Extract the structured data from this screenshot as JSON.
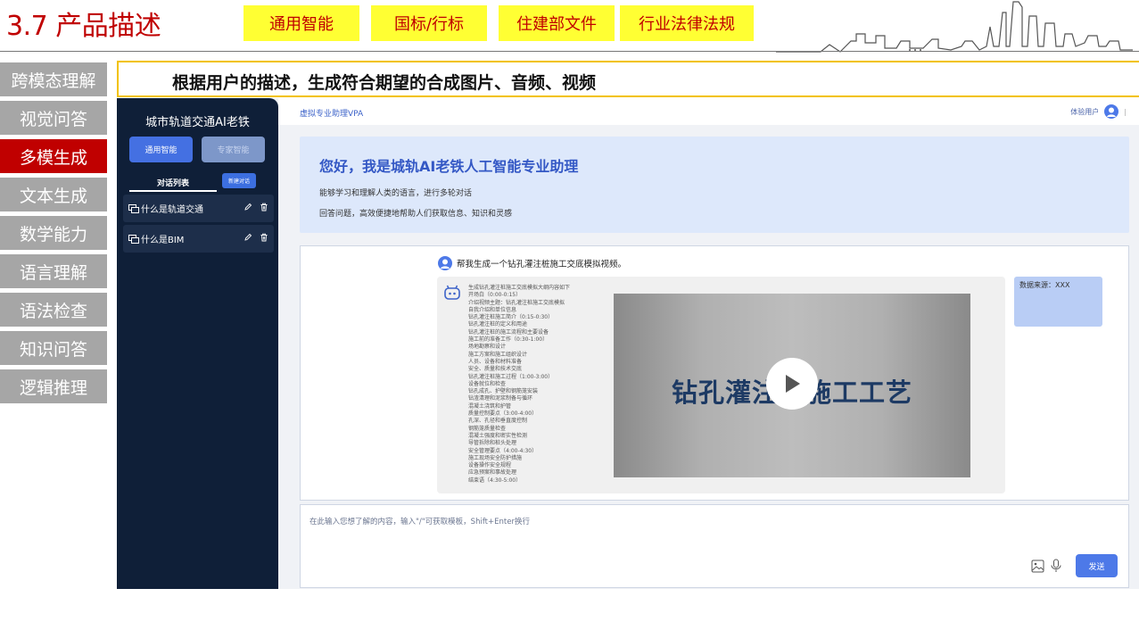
{
  "header": {
    "title": "3.7 产品描述",
    "tags": [
      "通用智能",
      "国标/行标",
      "住建部文件",
      "行业法律法规"
    ]
  },
  "sidebar": {
    "items": [
      "跨模态理解",
      "视觉问答",
      "多模生成",
      "文本生成",
      "数学能力",
      "语言理解",
      "语法检查",
      "知识问答",
      "逻辑推理"
    ],
    "active_index": 2
  },
  "subtitle": "根据用户的描述，生成符合期望的合成图片、音频、视频",
  "app": {
    "panel_title": "城市轨道交通AI老铁",
    "mode_general": "通用智能",
    "mode_expert": "专家智能",
    "tab_label": "对话列表",
    "new_chat": "新建对话",
    "conversations": [
      "什么是轨道交通",
      "什么是BIM"
    ],
    "brand": "虚拟专业助理VPA",
    "user_label": "体验用户",
    "welcome_title": "您好，我是城轨AI老铁人工智能专业助理",
    "welcome_line1": "能够学习和理解人类的语言，进行多轮对话",
    "welcome_line2": "回答问题，高效便捷地帮助人们获取信息、知识和灵感",
    "question": "帮我生成一个钻孔灌注桩施工交底模拟视频。",
    "answer_outline": [
      "生成钻孔灌注桩施工交底模拟大纲内容如下",
      "开场白（0:00-0:15）",
      "介绍视频主题：钻孔灌注桩施工交底模拟",
      "自我介绍和单位信息",
      "钻孔灌注桩施工简介（0:15-0:30）",
      "钻孔灌注桩的定义和用途",
      "钻孔灌注桩的施工流程和主要设备",
      "施工前的准备工作（0:30-1:00）",
      "场地勘察和设计",
      "施工方案和施工组织设计",
      "人员、设备和材料准备",
      "安全、质量和技术交底",
      "钻孔灌注桩施工过程（1:00-3:00）",
      "设备就位和检查",
      "钻孔成孔、护壁和钢筋笼安装",
      "钻渣清理和泥浆制备与循环",
      "混凝土浇筑和护管",
      "质量控制要点（3:00-4:00）",
      "孔深、孔径和垂直度控制",
      "钢筋笼质量检查",
      "混凝土强度和密实性检测",
      "导管拆除和桩头处理",
      "安全管理要点（4:00-4:30）",
      "施工现场安全防护措施",
      "设备操作安全规程",
      "应急预案和事故处理",
      "结束语（4:30-5:00）"
    ],
    "video_title": "钻孔灌注桩施工工艺",
    "source_label": "数据来源：XXX",
    "input_placeholder": "在此输入您想了解的内容，输入\"/\"可获取模板，Shift+Enter换行",
    "send_label": "发送"
  }
}
